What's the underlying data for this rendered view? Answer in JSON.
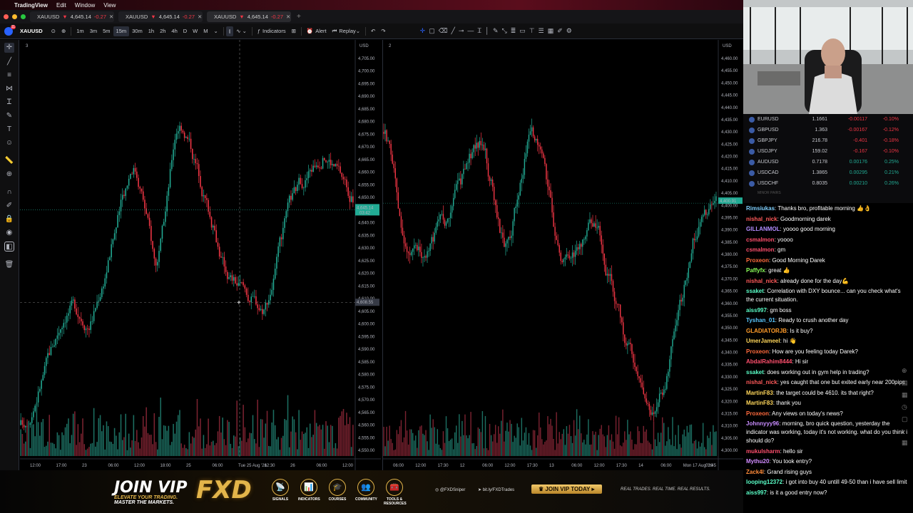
{
  "menubar": {
    "items": [
      "TradingView",
      "Edit",
      "Window",
      "View"
    ]
  },
  "tabs": [
    {
      "symbol": "XAUUSD",
      "price": "4,645.14",
      "change": "-0.27",
      "active": false
    },
    {
      "symbol": "XAUUSD",
      "price": "4,645.14",
      "change": "-0.27",
      "active": false
    },
    {
      "symbol": "XAUUSD",
      "price": "4,645.14",
      "change": "-0.27",
      "active": true
    }
  ],
  "toolbar": {
    "avatar_badge": "11",
    "symbol": "XAUUSD",
    "intervals": [
      "1m",
      "3m",
      "5m",
      "15m",
      "30m",
      "1h",
      "2h",
      "4h",
      "D",
      "W",
      "M"
    ],
    "selected_interval": "15m",
    "indicators": "Indicators",
    "alert": "Alert",
    "replay": "Replay"
  },
  "left_pane": {
    "label": "3",
    "currency": "USD",
    "price_ticks": [
      "4,705.00",
      "4,700.00",
      "4,695.00",
      "4,690.00",
      "4,685.00",
      "4,680.00",
      "4,675.00",
      "4,670.00",
      "4,665.00",
      "4,660.00",
      "4,655.00",
      "4,650.00",
      "4,645.00",
      "4,640.00",
      "4,635.00",
      "4,630.00",
      "4,625.00",
      "4,620.00",
      "4,615.00",
      "4,610.00",
      "4,605.00",
      "4,600.00",
      "4,595.00",
      "4,590.00",
      "4,585.00",
      "4,580.00",
      "4,575.00",
      "4,570.00",
      "4,565.00",
      "4,560.00",
      "4,555.00",
      "4,550.00"
    ],
    "current_price": "4,645.14",
    "current_countdown": "03:42",
    "crosshair_price": "4,608.55",
    "time_labels": [
      "12:00",
      "17:00",
      "23",
      "06:00",
      "12:00",
      "18:00",
      "25",
      "06:00",
      "Tue 25 Aug '26",
      "12:30",
      "26",
      "06:00",
      "12:00"
    ]
  },
  "right_pane": {
    "label": "2",
    "currency": "USD",
    "price_ticks": [
      "4,460.00",
      "4,455.00",
      "4,450.00",
      "4,445.00",
      "4,440.00",
      "4,435.00",
      "4,430.00",
      "4,425.00",
      "4,420.00",
      "4,415.00",
      "4,410.00",
      "4,405.00",
      "4,400.00",
      "4,395.00",
      "4,390.00",
      "4,385.00",
      "4,380.00",
      "4,375.00",
      "4,370.00",
      "4,365.00",
      "4,360.00",
      "4,355.00",
      "4,350.00",
      "4,345.00",
      "4,340.00",
      "4,335.00",
      "4,330.00",
      "4,325.00",
      "4,320.00",
      "4,315.00",
      "4,310.00",
      "4,305.00",
      "4,300.00"
    ],
    "current_price": "4,400.91",
    "time_labels": [
      "06:00",
      "12:00",
      "17:30",
      "12",
      "06:00",
      "12:00",
      "17:30",
      "13",
      "06:00",
      "12:00",
      "17:30",
      "14",
      "06:00",
      "Mon 17 Aug '26",
      "01:45"
    ]
  },
  "watchlist": [
    {
      "name": "EURUSD",
      "price": "1.1661",
      "change": "-0.00117",
      "pct": "-0.10%",
      "dir": "down"
    },
    {
      "name": "GBPUSD",
      "price": "1.363",
      "change": "-0.00167",
      "pct": "-0.12%",
      "dir": "down"
    },
    {
      "name": "GBPJPY",
      "price": "216.78",
      "change": "-0.401",
      "pct": "-0.18%",
      "dir": "down"
    },
    {
      "name": "USDJPY",
      "price": "159.02",
      "change": "-0.167",
      "pct": "-0.10%",
      "dir": "down"
    },
    {
      "name": "AUDUSD",
      "price": "0.7178",
      "change": "0.00176",
      "pct": "0.25%",
      "dir": "up"
    },
    {
      "name": "USDCAD",
      "price": "1.3865",
      "change": "0.00295",
      "pct": "0.21%",
      "dir": "up"
    },
    {
      "name": "USDCHF",
      "price": "0.8035",
      "change": "0.00210",
      "pct": "0.26%",
      "dir": "up"
    }
  ],
  "watchlist_section": "MINOR PAIRS",
  "chat": [
    {
      "user": "Rimsiukas",
      "color": "#7fd0ff",
      "text": "Thanks bro, profitable morning 👍👌"
    },
    {
      "user": "nishal_nick",
      "color": "#ff5a5a",
      "text": "Goodmorning darek"
    },
    {
      "user": "GILLANMOL",
      "color": "#b28cff",
      "text": "yoooo good morning"
    },
    {
      "user": "csmalmon",
      "color": "#ff4f6d",
      "text": "yoooo"
    },
    {
      "user": "csmalmon",
      "color": "#ff4f6d",
      "text": "gm"
    },
    {
      "user": "Proxeon",
      "color": "#ff6a3d",
      "text": "Good Morning Darek"
    },
    {
      "user": "Paffyfx",
      "color": "#8cff5a",
      "text": "great 👍"
    },
    {
      "user": "nishal_nick",
      "color": "#ff5a5a",
      "text": "already done for the day💪"
    },
    {
      "user": "ssaket",
      "color": "#5affc8",
      "text": "Correlation with DXY bounce... can you check what's the current situation."
    },
    {
      "user": "aiss997",
      "color": "#5affc8",
      "text": "gm boss"
    },
    {
      "user": "Tyshan_01",
      "color": "#5ac8ff",
      "text": "Ready to crush another day"
    },
    {
      "user": "GLADIATORJB",
      "color": "#ff9c2a",
      "text": "Is it buy?"
    },
    {
      "user": "UmerJameel",
      "color": "#ffd65a",
      "text": "hi 👋"
    },
    {
      "user": "Proxeon",
      "color": "#ff6a3d",
      "text": "How are you feeling today Darek?"
    },
    {
      "user": "AbdalRahim8444",
      "color": "#ff4f6d",
      "text": "Hi sir"
    },
    {
      "user": "ssaket",
      "color": "#5affc8",
      "text": "does working out in gym help in trading?"
    },
    {
      "user": "nishal_nick",
      "color": "#ff5a5a",
      "text": "yes caught that one but exited early near 200pips"
    },
    {
      "user": "MartinF83",
      "color": "#ffd65a",
      "text": "the target could be 4610. its that right?"
    },
    {
      "user": "MartinF83",
      "color": "#ffd65a",
      "text": "thank you"
    },
    {
      "user": "Proxeon",
      "color": "#ff6a3d",
      "text": "Any views on today's news?"
    },
    {
      "user": "Johnnyyy96",
      "color": "#c88cff",
      "text": "morning, bro quick question, yesterday the indicator was working, today it's not working. what do you think i should do?"
    },
    {
      "user": "mukulsharm",
      "color": "#ff4f6d",
      "text": "hello sir"
    },
    {
      "user": "Mythu20",
      "color": "#d28cff",
      "text": "You took entry?"
    },
    {
      "user": "Zack4l",
      "color": "#ff8c3a",
      "text": "Grand rising guys"
    },
    {
      "user": "looping12372",
      "color": "#5affc8",
      "text": "i got into buy 40 untill 49-50 than i have sell limit"
    },
    {
      "user": "aiss997",
      "color": "#5affc8",
      "text": "is it a good entry now?"
    }
  ],
  "promo": {
    "join": "JOIN VIP",
    "tag1": "ELEVATE YOUR TRADING.",
    "tag2": "MASTER THE MARKETS.",
    "brand": "FXD",
    "icons": [
      "SIGNALS",
      "INDICATORS",
      "COURSES",
      "COMMUNITY",
      "TOOLS & RESOURCES"
    ],
    "handle1": "@FXDSniper",
    "handle2": "bit.ly/FXDTrades",
    "cta": "JOIN VIP TODAY",
    "slogan": "REAL TRADES. REAL TIME. REAL RESULTS."
  },
  "colors": {
    "up": "#22ab94",
    "down": "#f23645",
    "current": "#22ab94",
    "volume_up": "#1c6e61",
    "volume_down": "#7a2230"
  }
}
